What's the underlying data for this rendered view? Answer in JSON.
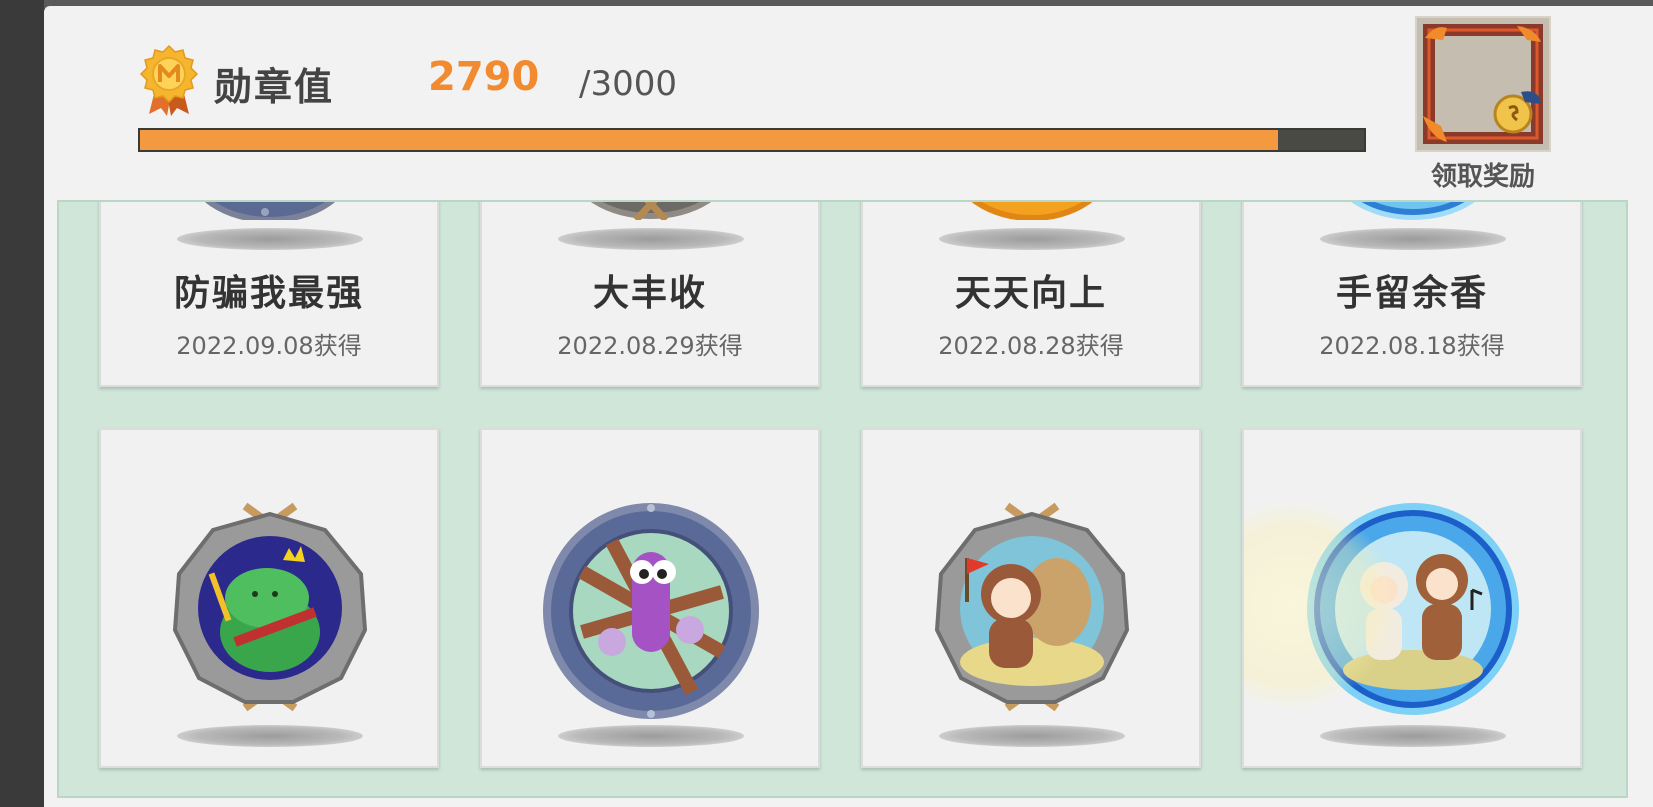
{
  "header": {
    "title": "勋章值",
    "current_value": "2790",
    "max_value": "/3000",
    "progress_fraction": 0.93,
    "reward_label": "领取奖励"
  },
  "badges_top": [
    {
      "name": "防骗我最强",
      "date": "2022.09.08获得",
      "style": "steel"
    },
    {
      "name": "大丰收",
      "date": "2022.08.29获得",
      "style": "rope"
    },
    {
      "name": "天天向上",
      "date": "2022.08.28获得",
      "style": "gold"
    },
    {
      "name": "手留余香",
      "date": "2022.08.18获得",
      "style": "crystal"
    }
  ],
  "badges_bottom": [
    {
      "icon": "green-king-badge-icon"
    },
    {
      "icon": "purple-worm-badge-icon"
    },
    {
      "icon": "bear-costume-flag-badge-icon"
    },
    {
      "icon": "dancing-bears-crystal-badge-icon"
    }
  ],
  "colors": {
    "accent_orange": "#f28a30",
    "grid_bg": "#cfe6d9"
  }
}
